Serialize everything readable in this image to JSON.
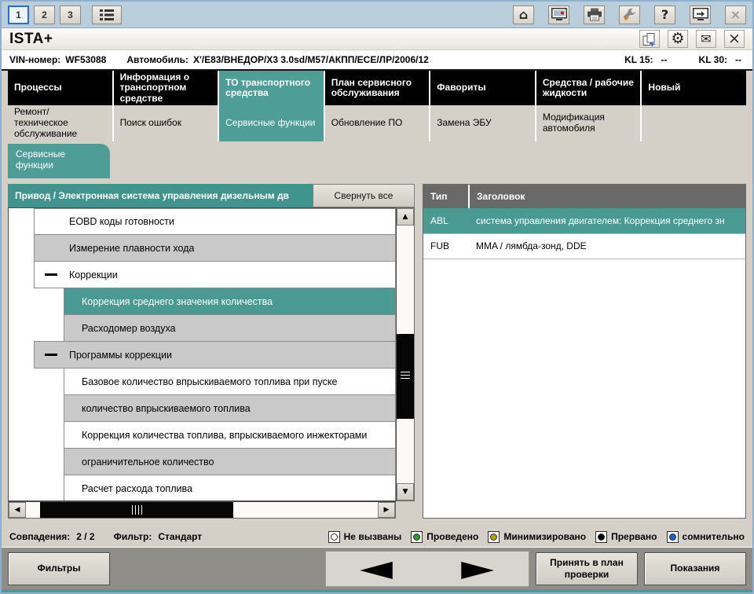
{
  "window": {
    "title": "ISTA+"
  },
  "colors": {
    "teal": "#4d9b94",
    "nav_black": "#000000",
    "panel_gray": "#d4d0c8"
  },
  "toolbar": {
    "pages": [
      {
        "label": "1"
      },
      {
        "label": "2"
      },
      {
        "label": "3"
      }
    ],
    "glyphs": {
      "home": "⌂",
      "help": "?",
      "close": "×",
      "gear": "⚙",
      "mail": "✉",
      "up": "▲",
      "down": "▼",
      "left": "◀",
      "right": "▶"
    }
  },
  "vinbar": {
    "vin_label": "VIN-номер:",
    "vin_value": "WF53088",
    "vehicle_label": "Автомобиль:",
    "vehicle_value": "X'/E83/ВНЕДОР/X3 3.0sd/M57/АКПП/ECE/ЛР/2006/12",
    "kl15_label": "KL 15:",
    "kl15_value": "--",
    "kl30_label": "KL 30:",
    "kl30_value": "--"
  },
  "main_tabs": [
    {
      "label": "Процессы"
    },
    {
      "label": "Информация о транспортном средстве"
    },
    {
      "label": "ТО транспортного средства"
    },
    {
      "label": "План сервисного обслуживания"
    },
    {
      "label": "Фавориты"
    },
    {
      "label": "Средства / рабочие жидкости"
    },
    {
      "label": "Новый"
    }
  ],
  "sub_tabs": [
    {
      "label": "Ремонт/ техническое обслуживание"
    },
    {
      "label": "Поиск ошибок"
    },
    {
      "label": "Сервисные функции"
    },
    {
      "label": "Обновление ПО"
    },
    {
      "label": "Замена ЭБУ"
    },
    {
      "label": "Модификация автомобиля"
    }
  ],
  "doc_tab": {
    "label": "Сервисные функции"
  },
  "tree": {
    "header": "Привод / Электронная система управления дизельным дв",
    "collapse_all": "Свернуть все",
    "items": [
      {
        "label": "EOBD коды готовности"
      },
      {
        "label": "Измерение плавности хода"
      },
      {
        "label": "Коррекции"
      },
      {
        "label": "Коррекция среднего значения количества"
      },
      {
        "label": "Расходомер воздуха"
      },
      {
        "label": "Программы коррекции"
      },
      {
        "label": "Базовое количество впрыскиваемого топлива при пуске"
      },
      {
        "label": "количество впрыскиваемого топлива"
      },
      {
        "label": "Коррекция количества топлива, впрыскиваемого инжекторами"
      },
      {
        "label": "ограничительное количество"
      },
      {
        "label": "Расчет расхода топлива"
      }
    ]
  },
  "results": {
    "columns": {
      "type": "Тип",
      "title": "Заголовок"
    },
    "rows": [
      {
        "type": "ABL",
        "title": "система управления двигателем: Коррекция среднего зн"
      },
      {
        "type": "FUB",
        "title": "MMA / лямбда-зонд, DDE"
      }
    ]
  },
  "statusbar": {
    "matches_label": "Совпадения:",
    "matches_value": "2 / 2",
    "filter_label": "Фильтр:",
    "filter_value": "Стандарт",
    "legend": [
      {
        "label": "Не вызваны",
        "color": "#ffffff"
      },
      {
        "label": "Проведено",
        "color": "#2e9b2e"
      },
      {
        "label": "Минимизировано",
        "color": "#b3a000"
      },
      {
        "label": "Прервано",
        "color": "#000000"
      },
      {
        "label": "сомнительно",
        "color": "#1f5fd0"
      }
    ]
  },
  "bottombar": {
    "filters": "Фильтры",
    "prev": "◀",
    "next": "▶",
    "accept": "Принять в план проверки",
    "readings": "Показания"
  }
}
